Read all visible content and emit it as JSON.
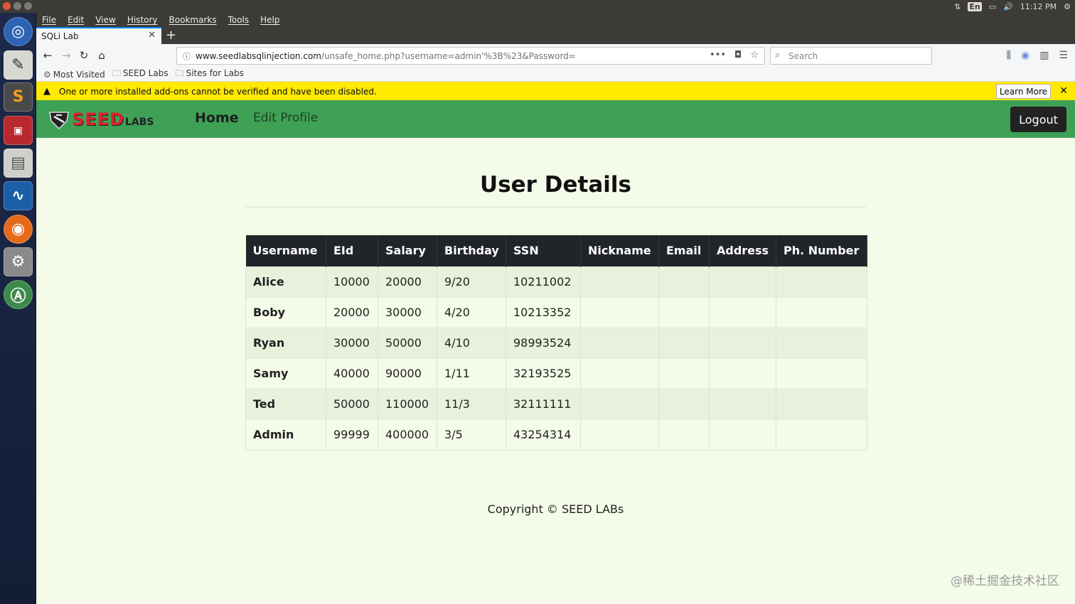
{
  "system": {
    "lang": "En",
    "clock": "11:12 PM"
  },
  "launcher": {
    "items": [
      "ubuntu-dash-icon",
      "text-editor-icon",
      "sublime-text-icon",
      "terminal-icon",
      "file-manager-icon",
      "wireshark-icon",
      "firefox-icon",
      "system-settings-icon",
      "software-updater-icon"
    ]
  },
  "browser": {
    "menu": [
      "File",
      "Edit",
      "View",
      "History",
      "Bookmarks",
      "Tools",
      "Help"
    ],
    "tab_title": "SQLi Lab",
    "url_host": "www.seedlabsqlinjection.com",
    "url_path": "/unsafe_home.php?username=admin'%3B%23&Password=",
    "search_placeholder": "Search",
    "bookmarks": [
      "Most Visited",
      "SEED Labs",
      "Sites for Labs"
    ],
    "notice_text": "One or more installed add-ons cannot be verified and have been disabled.",
    "notice_button": "Learn More"
  },
  "site": {
    "logo_main": "SEED",
    "logo_sub": "LABS",
    "nav_home": "Home",
    "nav_edit": "Edit Profile",
    "logout": "Logout",
    "title": "User Details",
    "footer": "Copyright © SEED LABs"
  },
  "table": {
    "headers": [
      "Username",
      "EId",
      "Salary",
      "Birthday",
      "SSN",
      "Nickname",
      "Email",
      "Address",
      "Ph. Number"
    ],
    "rows": [
      [
        "Alice",
        "10000",
        "20000",
        "9/20",
        "10211002",
        "",
        "",
        "",
        ""
      ],
      [
        "Boby",
        "20000",
        "30000",
        "4/20",
        "10213352",
        "",
        "",
        "",
        ""
      ],
      [
        "Ryan",
        "30000",
        "50000",
        "4/10",
        "98993524",
        "",
        "",
        "",
        ""
      ],
      [
        "Samy",
        "40000",
        "90000",
        "1/11",
        "32193525",
        "",
        "",
        "",
        ""
      ],
      [
        "Ted",
        "50000",
        "110000",
        "11/3",
        "32111111",
        "",
        "",
        "",
        ""
      ],
      [
        "Admin",
        "99999",
        "400000",
        "3/5",
        "43254314",
        "",
        "",
        "",
        ""
      ]
    ]
  },
  "watermark": "@稀土掘金技术社区"
}
